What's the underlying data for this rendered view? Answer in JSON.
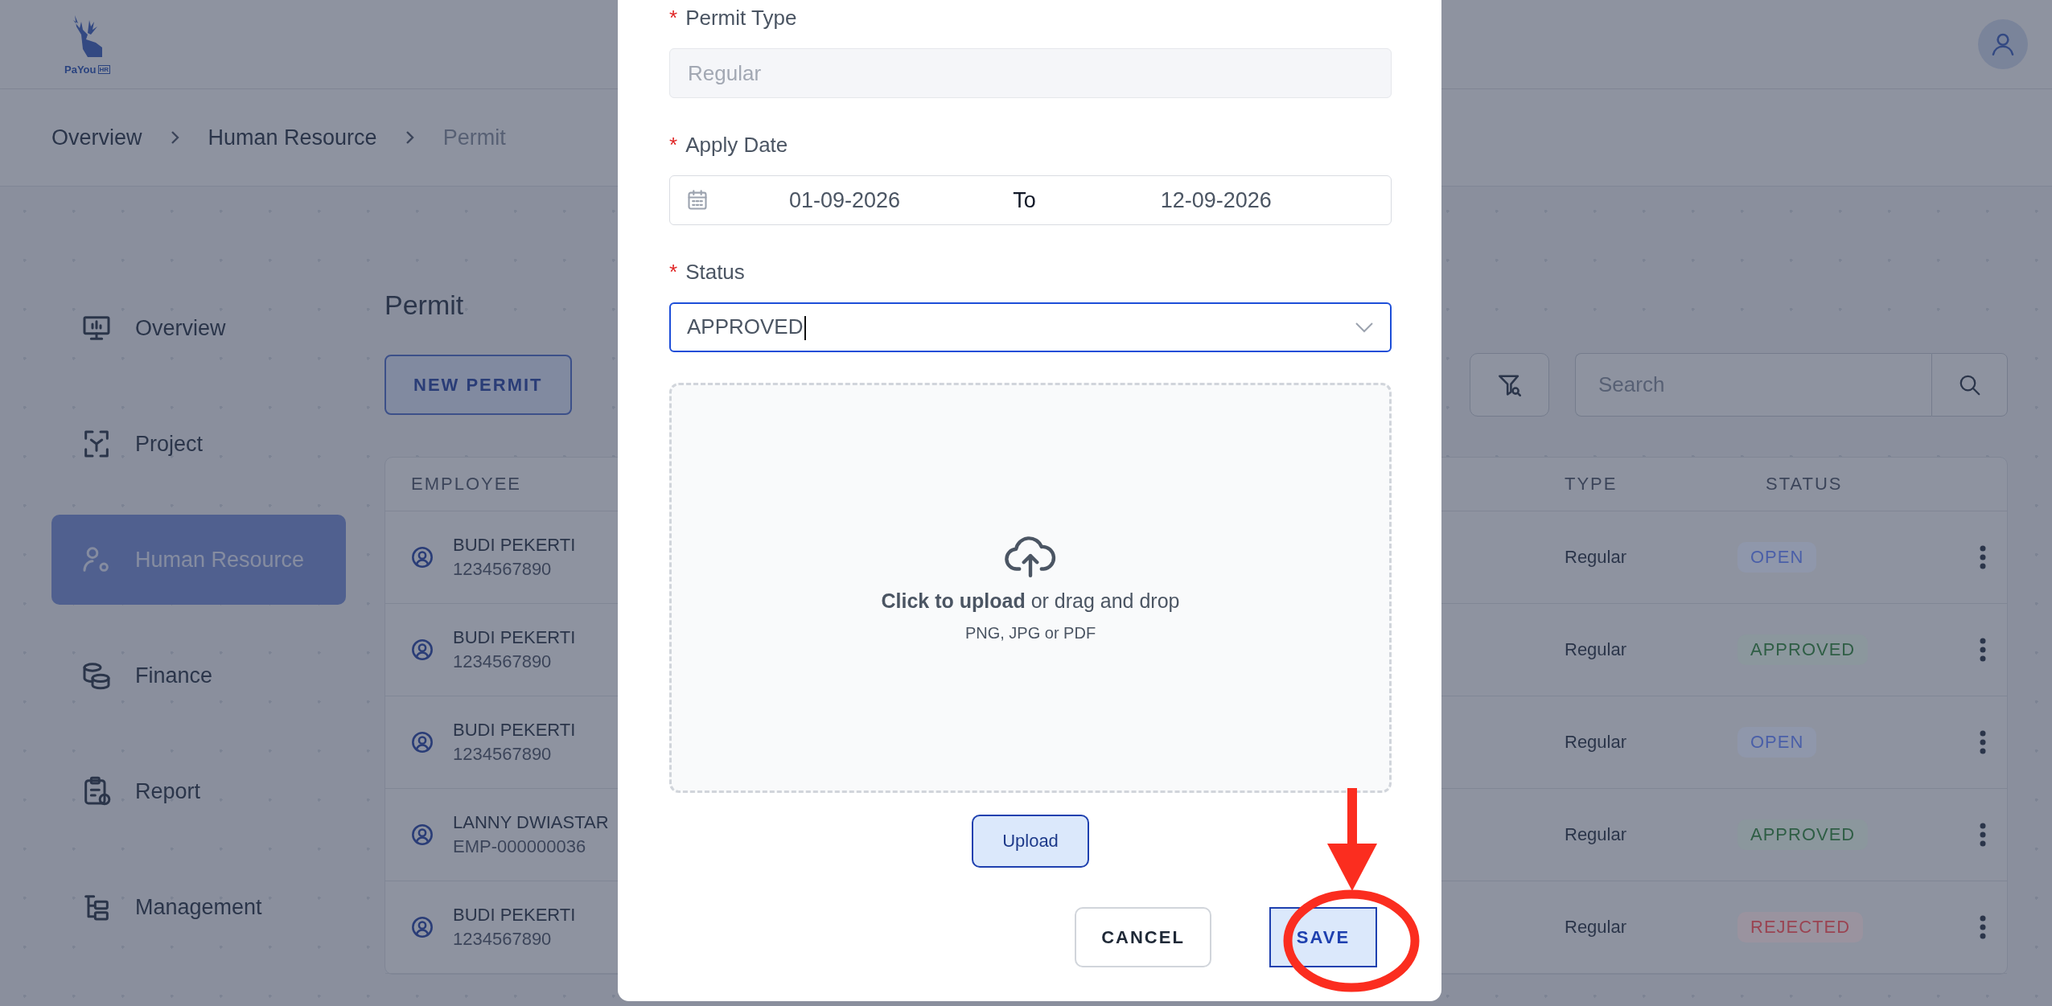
{
  "header": {
    "logo_text": "PaYou",
    "logo_badge": "HR"
  },
  "breadcrumb": [
    {
      "label": "Overview",
      "current": false
    },
    {
      "label": "Human Resource",
      "current": false
    },
    {
      "label": "Permit",
      "current": true
    }
  ],
  "sidebar": {
    "items": [
      {
        "label": "Overview",
        "selected": false
      },
      {
        "label": "Project",
        "selected": false
      },
      {
        "label": "Human Resource",
        "selected": true
      },
      {
        "label": "Finance",
        "selected": false
      },
      {
        "label": "Report",
        "selected": false
      },
      {
        "label": "Management",
        "selected": false
      }
    ]
  },
  "page": {
    "title": "Permit",
    "new_button": "NEW PERMIT",
    "search": {
      "placeholder": "Search"
    }
  },
  "table": {
    "columns": [
      "EMPLOYEE",
      "TYPE",
      "STATUS"
    ],
    "rows": [
      {
        "name": "BUDI PEKERTI",
        "id": "1234567890",
        "type": "Regular",
        "status": "OPEN",
        "color": "#4a5fa8"
      },
      {
        "name": "BUDI PEKERTI",
        "id": "1234567890",
        "type": "Regular",
        "status": "APPROVED",
        "color": "#2f5e45"
      },
      {
        "name": "BUDI PEKERTI",
        "id": "1234567890",
        "type": "Regular",
        "status": "OPEN",
        "color": "#4a5fa8"
      },
      {
        "name": "LANNY DWIASTAR",
        "id": "EMP-000000036",
        "type": "Regular",
        "status": "APPROVED",
        "color": "#2f5e45"
      },
      {
        "name": "BUDI PEKERTI",
        "id": "1234567890",
        "type": "Regular",
        "status": "REJECTED",
        "color": "#9a4452"
      }
    ]
  },
  "modal": {
    "fields": [
      {
        "kind": "readonly",
        "label": "Permit Type",
        "required_mark": "*",
        "value": "Regular"
      },
      {
        "kind": "daterange",
        "label": "Apply Date",
        "required_mark": "*",
        "from": "01-09-2026",
        "separator": "To",
        "to": "12-09-2026"
      },
      {
        "kind": "select",
        "label": "Status",
        "required_mark": "*",
        "value": "APPROVED",
        "focused": true
      }
    ],
    "upload": {
      "text": "**Click to upload** or drag and drop",
      "hint": "PNG, JPG or PDF",
      "button": "Upload"
    },
    "buttons": [
      {
        "label": "CANCEL",
        "kind": "secondary"
      },
      {
        "label": "SAVE",
        "kind": "primary"
      }
    ]
  },
  "annotation": {
    "kind": "arrow_circle"
  }
}
